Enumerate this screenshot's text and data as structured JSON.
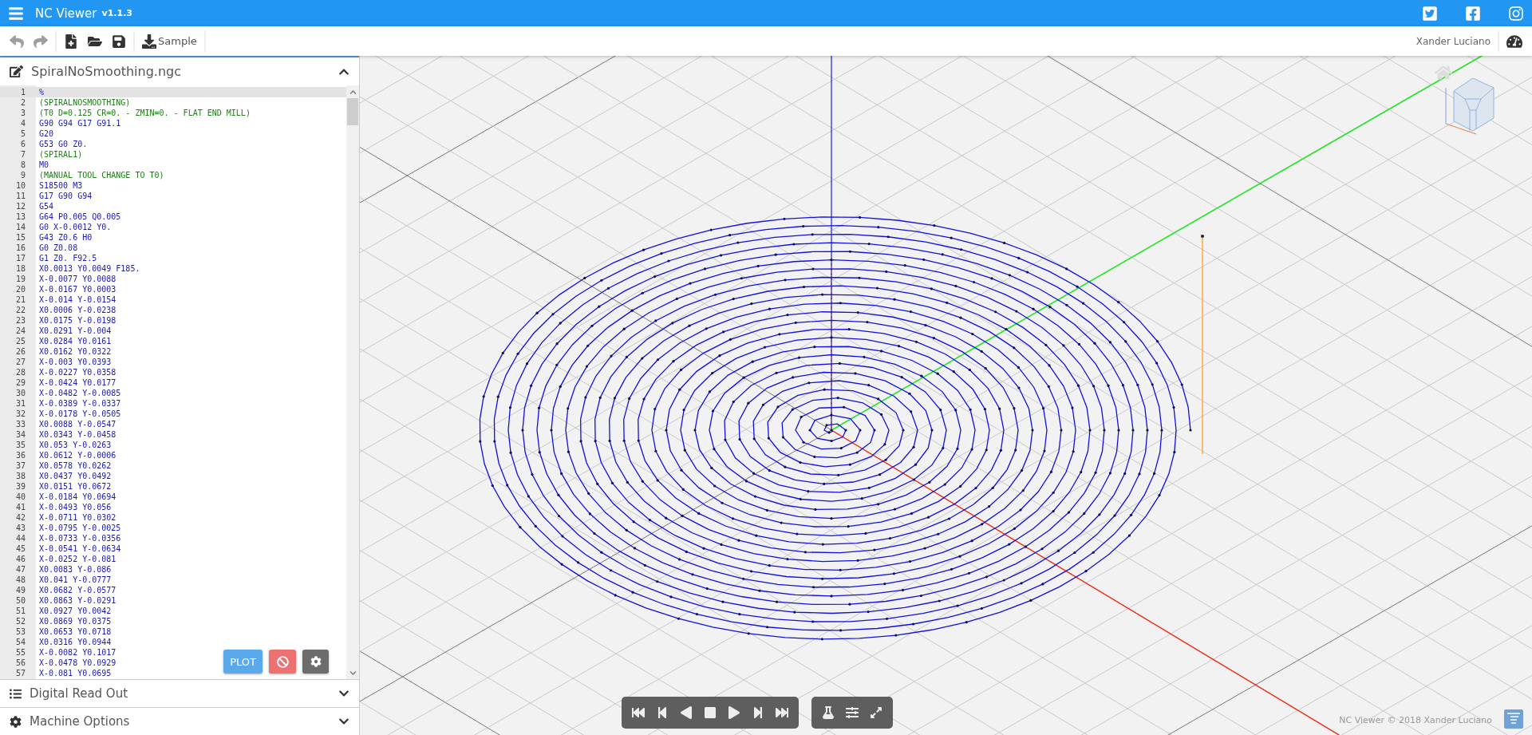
{
  "app": {
    "title": "NC Viewer",
    "version": "v1.1.3"
  },
  "toolbar": {
    "undo": {
      "disabled": true
    },
    "redo": {
      "disabled": true
    },
    "sample_button": "Sample",
    "user": "Xander Luciano"
  },
  "editor": {
    "filename": "SpiralNoSmoothing.ngc",
    "expanded": true,
    "plot_button": "PLOT",
    "lines": [
      {
        "n": "1",
        "text": "%",
        "kind": "code",
        "selected": true
      },
      {
        "n": "2",
        "text": "(SPIRALNOSMOOTHING)",
        "kind": "comment",
        "selected": false
      },
      {
        "n": "3",
        "text": "(T0 D=0.125 CR=0. - ZMIN=0. - FLAT END MILL)",
        "kind": "comment",
        "selected": false
      },
      {
        "n": "4",
        "text": "G90 G94 G17 G91.1",
        "kind": "code",
        "selected": false
      },
      {
        "n": "5",
        "text": "G20",
        "kind": "code",
        "selected": false
      },
      {
        "n": "6",
        "text": "G53 G0 Z0.",
        "kind": "code",
        "selected": false
      },
      {
        "n": "7",
        "text": "(SPIRAL1)",
        "kind": "comment",
        "selected": false
      },
      {
        "n": "8",
        "text": "M0",
        "kind": "code",
        "selected": false
      },
      {
        "n": "9",
        "text": "(MANUAL TOOL CHANGE TO T0)",
        "kind": "comment",
        "selected": false
      },
      {
        "n": "10",
        "text": "S18500 M3",
        "kind": "code",
        "selected": false
      },
      {
        "n": "11",
        "text": "G17 G90 G94",
        "kind": "code",
        "selected": false
      },
      {
        "n": "12",
        "text": "G54",
        "kind": "code",
        "selected": false
      },
      {
        "n": "13",
        "text": "G64 P0.005 Q0.005",
        "kind": "code",
        "selected": false
      },
      {
        "n": "14",
        "text": "G0 X-0.0012 Y0.",
        "kind": "code",
        "selected": false
      },
      {
        "n": "15",
        "text": "G43 Z0.6 H0",
        "kind": "code",
        "selected": false
      },
      {
        "n": "16",
        "text": "G0 Z0.08",
        "kind": "code",
        "selected": false
      },
      {
        "n": "17",
        "text": "G1 Z0. F92.5",
        "kind": "code",
        "selected": false
      },
      {
        "n": "18",
        "text": "X0.0013 Y0.0049 F185.",
        "kind": "code",
        "selected": false
      },
      {
        "n": "19",
        "text": "X-0.0077 Y0.0088",
        "kind": "code",
        "selected": false
      },
      {
        "n": "20",
        "text": "X-0.0167 Y0.0003",
        "kind": "code",
        "selected": false
      },
      {
        "n": "21",
        "text": "X-0.014 Y-0.0154",
        "kind": "code",
        "selected": false
      },
      {
        "n": "22",
        "text": "X0.0006 Y-0.0238",
        "kind": "code",
        "selected": false
      },
      {
        "n": "23",
        "text": "X0.0175 Y-0.0198",
        "kind": "code",
        "selected": false
      },
      {
        "n": "24",
        "text": "X0.0291 Y-0.004",
        "kind": "code",
        "selected": false
      },
      {
        "n": "25",
        "text": "X0.0284 Y0.0161",
        "kind": "code",
        "selected": false
      },
      {
        "n": "26",
        "text": "X0.0162 Y0.0322",
        "kind": "code",
        "selected": false
      },
      {
        "n": "27",
        "text": "X-0.003 Y0.0393",
        "kind": "code",
        "selected": false
      },
      {
        "n": "28",
        "text": "X-0.0227 Y0.0358",
        "kind": "code",
        "selected": false
      },
      {
        "n": "29",
        "text": "X-0.0424 Y0.0177",
        "kind": "code",
        "selected": false
      },
      {
        "n": "30",
        "text": "X-0.0482 Y-0.0085",
        "kind": "code",
        "selected": false
      },
      {
        "n": "31",
        "text": "X-0.0389 Y-0.0337",
        "kind": "code",
        "selected": false
      },
      {
        "n": "32",
        "text": "X-0.0178 Y-0.0505",
        "kind": "code",
        "selected": false
      },
      {
        "n": "33",
        "text": "X0.0088 Y-0.0547",
        "kind": "code",
        "selected": false
      },
      {
        "n": "34",
        "text": "X0.0343 Y-0.0458",
        "kind": "code",
        "selected": false
      },
      {
        "n": "35",
        "text": "X0.053 Y-0.0263",
        "kind": "code",
        "selected": false
      },
      {
        "n": "36",
        "text": "X0.0612 Y-0.0006",
        "kind": "code",
        "selected": false
      },
      {
        "n": "37",
        "text": "X0.0578 Y0.0262",
        "kind": "code",
        "selected": false
      },
      {
        "n": "38",
        "text": "X0.0437 Y0.0492",
        "kind": "code",
        "selected": false
      },
      {
        "n": "39",
        "text": "X0.0151 Y0.0672",
        "kind": "code",
        "selected": false
      },
      {
        "n": "40",
        "text": "X-0.0184 Y0.0694",
        "kind": "code",
        "selected": false
      },
      {
        "n": "41",
        "text": "X-0.0493 Y0.056",
        "kind": "code",
        "selected": false
      },
      {
        "n": "42",
        "text": "X-0.0711 Y0.0302",
        "kind": "code",
        "selected": false
      },
      {
        "n": "43",
        "text": "X-0.0795 Y-0.0025",
        "kind": "code",
        "selected": false
      },
      {
        "n": "44",
        "text": "X-0.0733 Y-0.0356",
        "kind": "code",
        "selected": false
      },
      {
        "n": "45",
        "text": "X-0.0541 Y-0.0634",
        "kind": "code",
        "selected": false
      },
      {
        "n": "46",
        "text": "X-0.0252 Y-0.081",
        "kind": "code",
        "selected": false
      },
      {
        "n": "47",
        "text": "X0.0083 Y-0.086",
        "kind": "code",
        "selected": false
      },
      {
        "n": "48",
        "text": "X0.041 Y-0.0777",
        "kind": "code",
        "selected": false
      },
      {
        "n": "49",
        "text": "X0.0682 Y-0.0577",
        "kind": "code",
        "selected": false
      },
      {
        "n": "50",
        "text": "X0.0863 Y-0.0291",
        "kind": "code",
        "selected": false
      },
      {
        "n": "51",
        "text": "X0.0927 Y0.0042",
        "kind": "code",
        "selected": false
      },
      {
        "n": "52",
        "text": "X0.0869 Y0.0375",
        "kind": "code",
        "selected": false
      },
      {
        "n": "53",
        "text": "X0.0653 Y0.0718",
        "kind": "code",
        "selected": false
      },
      {
        "n": "54",
        "text": "X0.0316 Y0.0944",
        "kind": "code",
        "selected": false
      },
      {
        "n": "55",
        "text": "X-0.0082 Y0.1017",
        "kind": "code",
        "selected": false
      },
      {
        "n": "56",
        "text": "X-0.0478 Y0.0929",
        "kind": "code",
        "selected": false
      },
      {
        "n": "57",
        "text": "X-0.081 Y0.0695",
        "kind": "code",
        "selected": false
      }
    ]
  },
  "panels": [
    {
      "title": "Digital Read Out",
      "kind": "list",
      "expanded": false
    },
    {
      "title": "Machine Options",
      "kind": "gear",
      "expanded": false
    }
  ],
  "footer": "NC Viewer © 2018 Xander Luciano"
}
